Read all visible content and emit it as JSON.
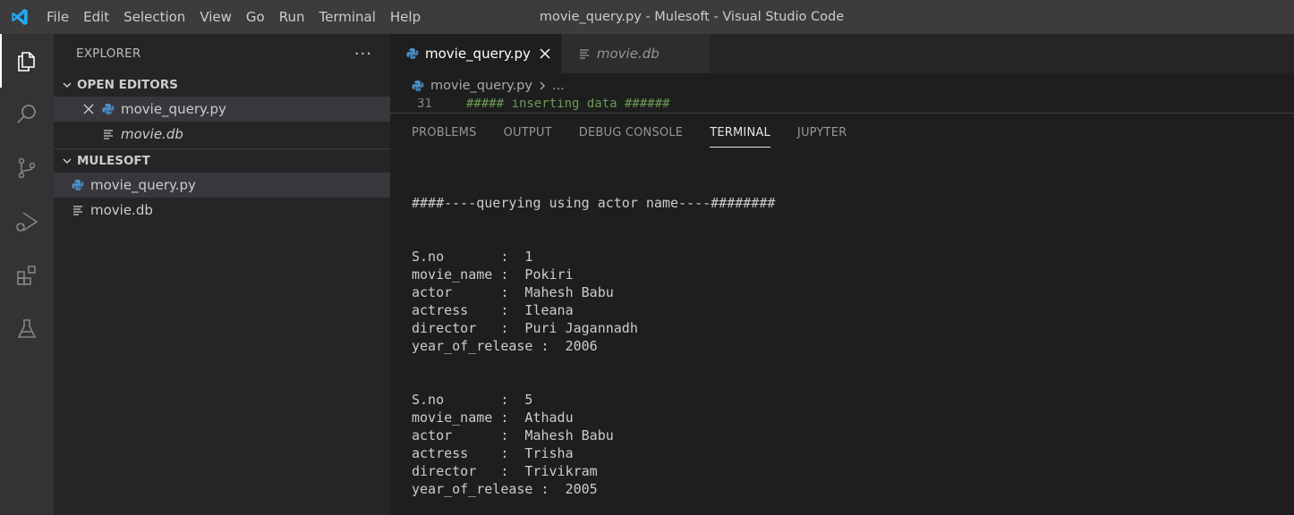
{
  "menu": [
    "File",
    "Edit",
    "Selection",
    "View",
    "Go",
    "Run",
    "Terminal",
    "Help"
  ],
  "window_title": "movie_query.py - Mulesoft - Visual Studio Code",
  "activity_icons": [
    "explorer-icon",
    "search-icon",
    "source-control-icon",
    "run-debug-icon",
    "extensions-icon",
    "testing-icon"
  ],
  "sidebar": {
    "title": "EXPLORER",
    "more": "···",
    "open_editors": {
      "label": "OPEN EDITORS",
      "items": [
        {
          "name": "movie_query.py",
          "icon": "python-file-icon"
        },
        {
          "name": "movie.db",
          "icon": "text-file-icon"
        }
      ]
    },
    "folder": {
      "label": "MULESOFT",
      "items": [
        {
          "name": "movie_query.py",
          "icon": "python-file-icon"
        },
        {
          "name": "movie.db",
          "icon": "text-file-icon"
        }
      ]
    }
  },
  "tabs": [
    {
      "label": "movie_query.py",
      "icon": "python-file-icon",
      "active": true
    },
    {
      "label": "movie.db",
      "icon": "text-file-icon",
      "active": false
    }
  ],
  "breadcrumb": {
    "file": "movie_query.py",
    "rest": "..."
  },
  "code_peek": {
    "line": "31",
    "text": "##### inserting data ######"
  },
  "panel": {
    "tabs": [
      "PROBLEMS",
      "OUTPUT",
      "DEBUG CONSOLE",
      "TERMINAL",
      "JUPYTER"
    ],
    "active_tab": "TERMINAL"
  },
  "terminal_lines": [
    "",
    "",
    "####----querying using actor name----########",
    "",
    "",
    "S.no       :  1",
    "movie_name :  Pokiri",
    "actor      :  Mahesh Babu",
    "actress    :  Ileana",
    "director   :  Puri Jagannadh",
    "year_of_release :  2006",
    "",
    "",
    "S.no       :  5",
    "movie_name :  Athadu",
    "actor      :  Mahesh Babu",
    "actress    :  Trisha",
    "director   :  Trivikram",
    "year_of_release :  2005"
  ],
  "colors": {
    "accent": "#23a9f2",
    "titlebar": "#3c3c3c",
    "sidebar": "#252526",
    "activitybar": "#333333",
    "editor": "#1e1e1e",
    "comment": "#6a9955"
  }
}
